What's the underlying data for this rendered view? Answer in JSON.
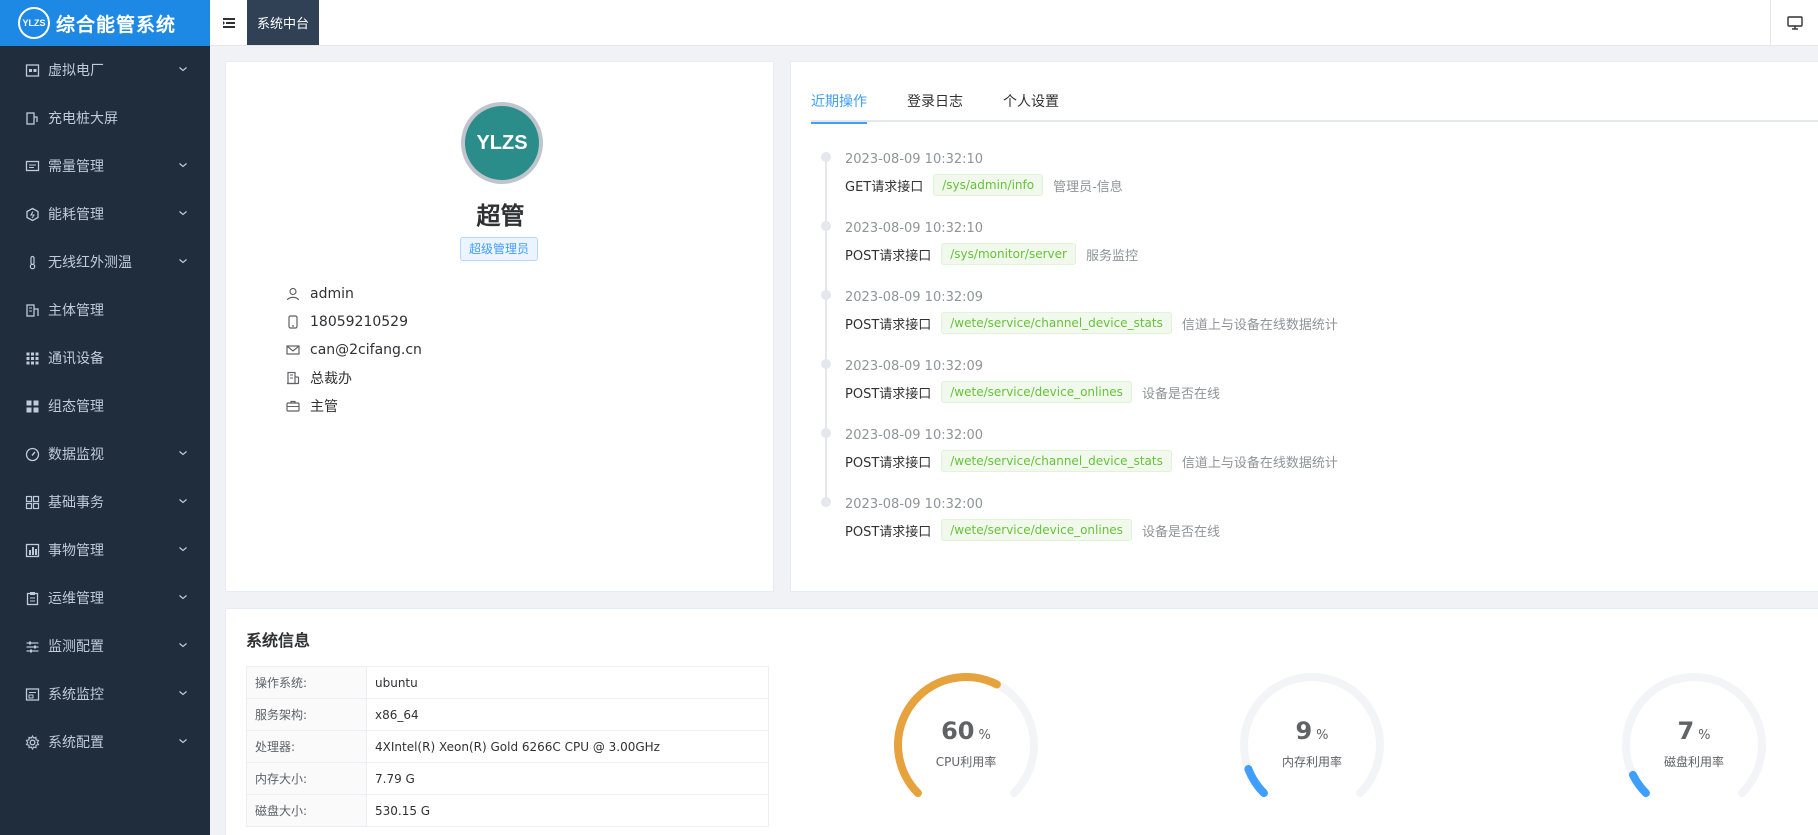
{
  "brand": {
    "logo_text": "YLZS",
    "title": "综合能管系统"
  },
  "sidebar": {
    "items": [
      {
        "label": "虚拟电厂",
        "has_children": true
      },
      {
        "label": "充电桩大屏",
        "has_children": false
      },
      {
        "label": "需量管理",
        "has_children": true
      },
      {
        "label": "能耗管理",
        "has_children": true
      },
      {
        "label": "无线红外测温",
        "has_children": true
      },
      {
        "label": "主体管理",
        "has_children": false
      },
      {
        "label": "通讯设备",
        "has_children": false
      },
      {
        "label": "组态管理",
        "has_children": false
      },
      {
        "label": "数据监视",
        "has_children": true
      },
      {
        "label": "基础事务",
        "has_children": true
      },
      {
        "label": "事物管理",
        "has_children": true
      },
      {
        "label": "运维管理",
        "has_children": true
      },
      {
        "label": "监测配置",
        "has_children": true
      },
      {
        "label": "系统监控",
        "has_children": true
      },
      {
        "label": "系统配置",
        "has_children": true
      }
    ]
  },
  "topbar": {
    "active_tab": "系统中台"
  },
  "profile": {
    "avatar_text": "YLZS",
    "name": "超管",
    "role_tag": "超级管理员",
    "username": "admin",
    "phone": "18059210529",
    "email": "can@2cifang.cn",
    "department": "总裁办",
    "position": "主管"
  },
  "activity": {
    "tabs": [
      "近期操作",
      "登录日志",
      "个人设置"
    ],
    "entries": [
      {
        "time": "2023-08-09 10:32:10",
        "method": "GET请求接口",
        "path": "/sys/admin/info",
        "desc": "管理员-信息"
      },
      {
        "time": "2023-08-09 10:32:10",
        "method": "POST请求接口",
        "path": "/sys/monitor/server",
        "desc": "服务监控"
      },
      {
        "time": "2023-08-09 10:32:09",
        "method": "POST请求接口",
        "path": "/wete/service/channel_device_stats",
        "desc": "信道上与设备在线数据统计"
      },
      {
        "time": "2023-08-09 10:32:09",
        "method": "POST请求接口",
        "path": "/wete/service/device_onlines",
        "desc": "设备是否在线"
      },
      {
        "time": "2023-08-09 10:32:00",
        "method": "POST请求接口",
        "path": "/wete/service/channel_device_stats",
        "desc": "信道上与设备在线数据统计"
      },
      {
        "time": "2023-08-09 10:32:00",
        "method": "POST请求接口",
        "path": "/wete/service/device_onlines",
        "desc": "设备是否在线"
      }
    ]
  },
  "sysinfo": {
    "title": "系统信息",
    "rows": [
      {
        "key": "操作系统:",
        "value": "ubuntu"
      },
      {
        "key": "服务架构:",
        "value": "x86_64"
      },
      {
        "key": "处理器:",
        "value": "4XIntel(R) Xeon(R) Gold 6266C CPU @ 3.00GHz"
      },
      {
        "key": "内存大小:",
        "value": "7.79 G"
      },
      {
        "key": "磁盘大小:",
        "value": "530.15 G"
      }
    ],
    "gauges": [
      {
        "value": 60,
        "unit": "%",
        "label": "CPU利用率",
        "color": "#e6a23c"
      },
      {
        "value": 9,
        "unit": "%",
        "label": "内存利用率",
        "color": "#409eff"
      },
      {
        "value": 7,
        "unit": "%",
        "label": "磁盘利用率",
        "color": "#409eff"
      }
    ]
  },
  "colors": {
    "sidebar_bg": "#1f2d3d",
    "brand_bg": "#1e88e5",
    "accent": "#409eff",
    "success": "#67c23a"
  }
}
